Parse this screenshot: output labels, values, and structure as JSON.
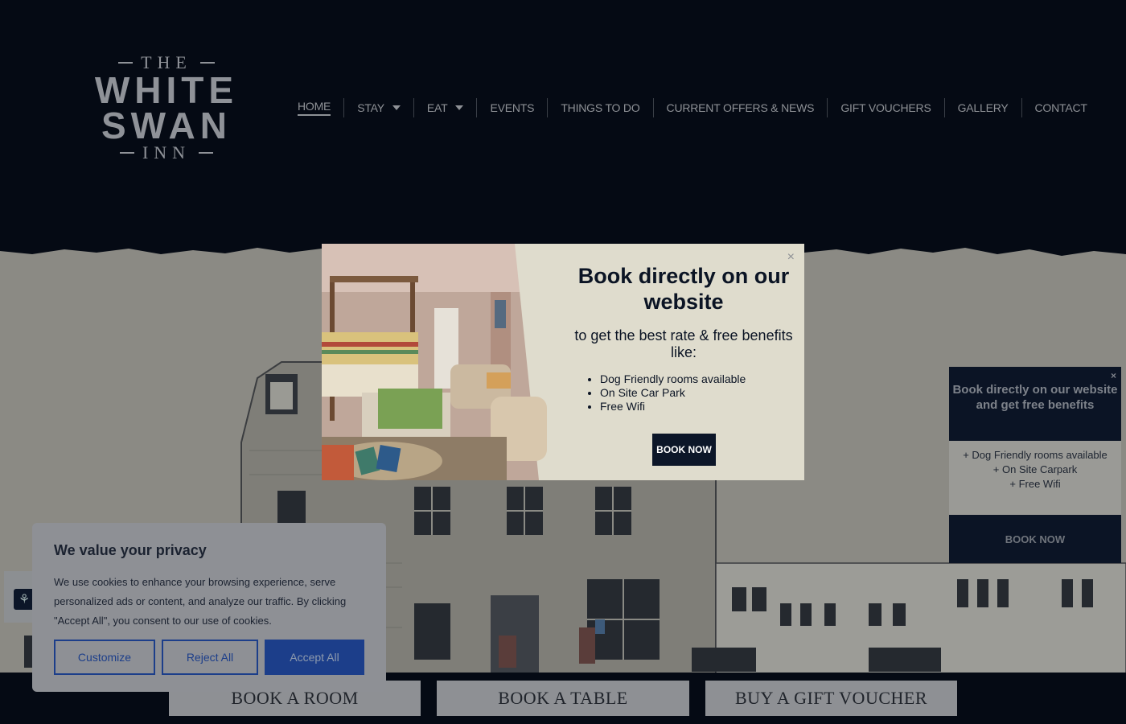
{
  "logo": {
    "line1": "THE",
    "line2": "WHITE",
    "line3": "SWAN",
    "line4": "INN"
  },
  "nav": [
    {
      "label": "HOME",
      "active": true,
      "dropdown": false
    },
    {
      "label": "STAY",
      "active": false,
      "dropdown": true
    },
    {
      "label": "EAT",
      "active": false,
      "dropdown": true
    },
    {
      "label": "EVENTS",
      "active": false,
      "dropdown": false
    },
    {
      "label": "THINGS TO DO",
      "active": false,
      "dropdown": false
    },
    {
      "label": "CURRENT OFFERS & NEWS",
      "active": false,
      "dropdown": false
    },
    {
      "label": "GIFT VOUCHERS",
      "active": false,
      "dropdown": false
    },
    {
      "label": "GALLERY",
      "active": false,
      "dropdown": false
    },
    {
      "label": "CONTACT",
      "active": false,
      "dropdown": false
    }
  ],
  "popup": {
    "title": "Book directly on our website",
    "subtitle": "to get the best rate & free benefits like:",
    "benefits": [
      "Dog Friendly rooms available",
      "On Site Car Park",
      "Free Wifi"
    ],
    "button": "BOOK NOW",
    "close": "×"
  },
  "side_widget": {
    "title": "Book directly on our website and get free benefits",
    "benefits": [
      "+ Dog Friendly rooms available",
      "+ On Site Carpark",
      "+ Free Wifi"
    ],
    "button": "BOOK NOW",
    "close": "×"
  },
  "cookie": {
    "title": "We value your privacy",
    "text": "We use cookies to enhance your browsing experience, serve personalized ads or content, and analyze our traffic. By clicking \"Accept All\", you consent to our use of cookies.",
    "customize": "Customize",
    "reject": "Reject All",
    "accept": "Accept All"
  },
  "cta": {
    "room": "BOOK A ROOM",
    "table": "BOOK A TABLE",
    "voucher": "BUY A GIFT VOUCHER"
  },
  "colors": {
    "header_bg": "#050a14",
    "accent_navy": "#0c1628",
    "popup_bg": "#dfdccd",
    "button_blue": "#1c3e8a"
  }
}
